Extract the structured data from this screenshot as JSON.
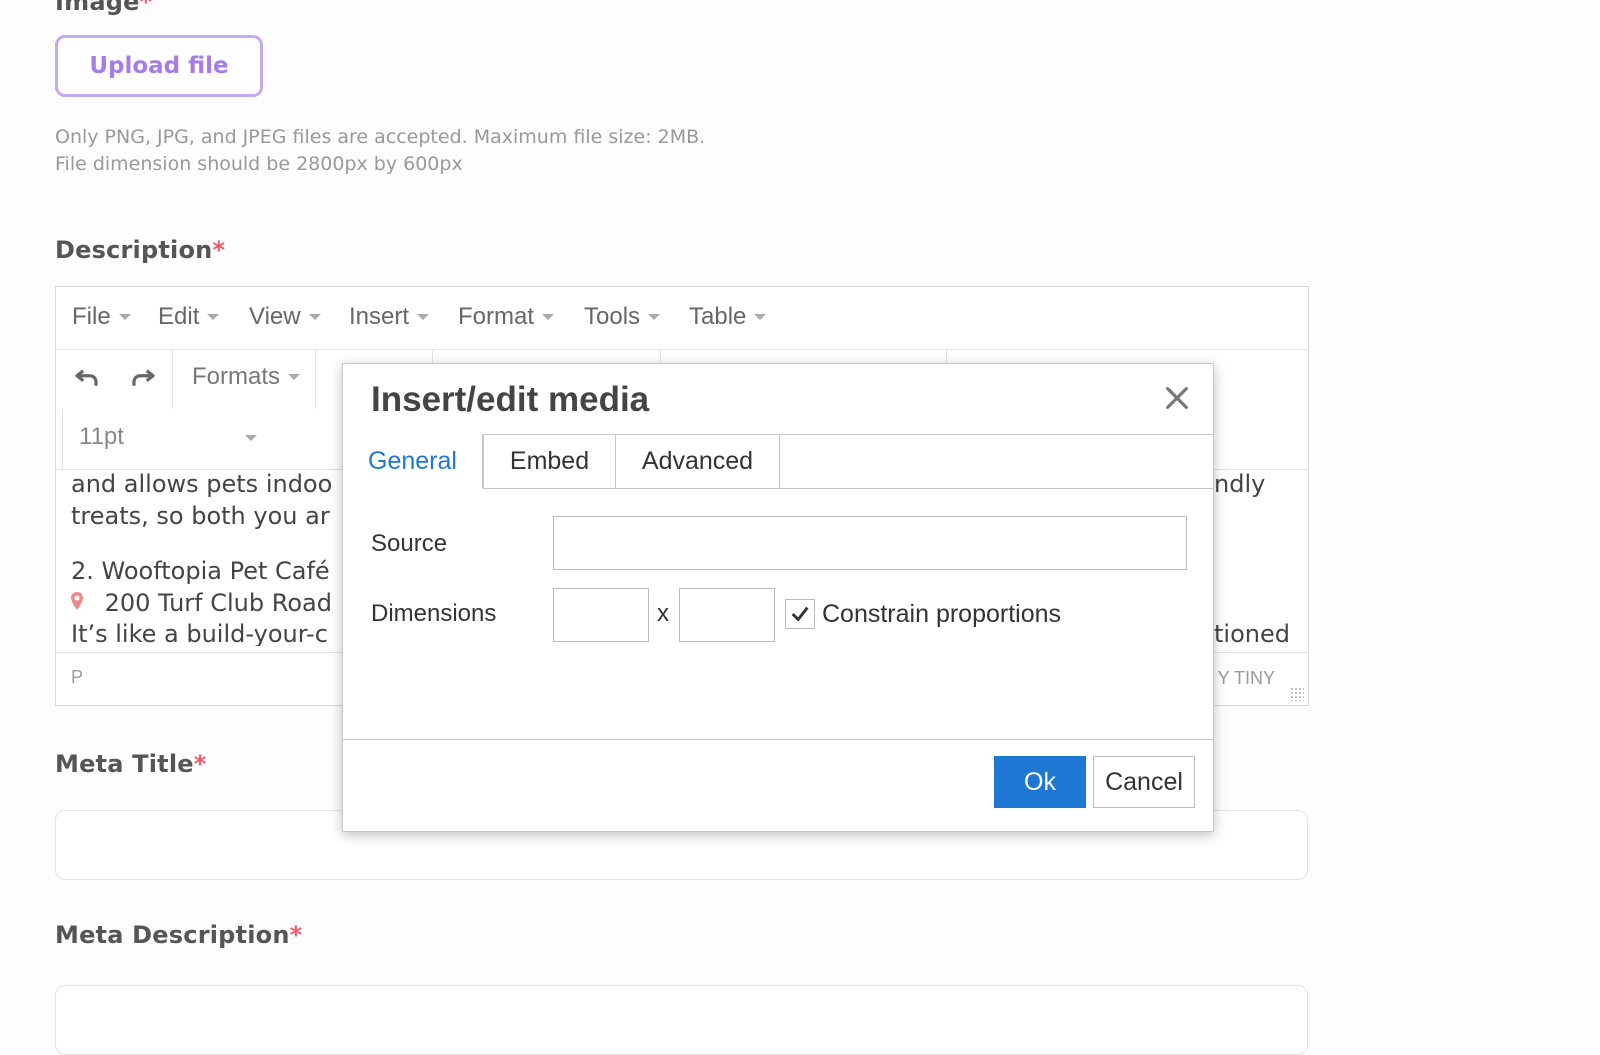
{
  "image_field": {
    "label": "Image",
    "required_mark": "*",
    "upload_label": "Upload file",
    "hint_line1": "Only PNG, JPG, and JPEG files are accepted. Maximum file size: 2MB.",
    "hint_line2": "File dimension should be 2800px by 600px"
  },
  "description_field": {
    "label": "Description",
    "required_mark": "*"
  },
  "editor": {
    "menu": [
      "File",
      "Edit",
      "View",
      "Insert",
      "Format",
      "Tools",
      "Table"
    ],
    "formats_label": "Formats",
    "font_size": "11pt",
    "content_left": [
      "and allows pets indoo",
      "treats, so both you ar",
      "2. Wooftopia Pet Café",
      "200 Turf Club Road",
      "It’s like a build-your-c"
    ],
    "content_right": [
      "ndly",
      "tioned"
    ],
    "status_path": "P",
    "powered_by": "Y TINY"
  },
  "modal": {
    "title": "Insert/edit media",
    "tabs": [
      "General",
      "Embed",
      "Advanced"
    ],
    "active_tab": "General",
    "source_label": "Source",
    "source_value": "",
    "dimensions_label": "Dimensions",
    "width_value": "",
    "height_value": "",
    "dimension_separator": "x",
    "constrain_label": "Constrain proportions",
    "constrain_checked": true,
    "ok_label": "Ok",
    "cancel_label": "Cancel",
    "accent_color": "#1f77d4"
  },
  "meta_title_field": {
    "label": "Meta Title",
    "required_mark": "*"
  },
  "meta_description_field": {
    "label": "Meta Description",
    "required_mark": "*"
  },
  "icons": [
    "undo-icon",
    "redo-icon",
    "close-icon",
    "checkmark-icon",
    "location-pin-icon",
    "resize-handle-icon"
  ]
}
